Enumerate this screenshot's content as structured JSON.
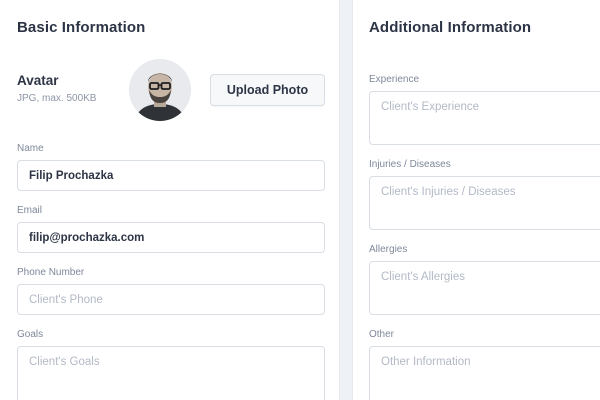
{
  "basic": {
    "title": "Basic Information",
    "avatar_label": "Avatar",
    "avatar_hint": "JPG, max. 500KB",
    "upload_label": "Upload Photo",
    "name": {
      "label": "Name",
      "value": "Filip Prochazka"
    },
    "email": {
      "label": "Email",
      "value": "filip@prochazka.com"
    },
    "phone": {
      "label": "Phone Number",
      "placeholder": "Client's Phone"
    },
    "goals": {
      "label": "Goals",
      "placeholder": "Client's Goals"
    }
  },
  "additional": {
    "title": "Additional Information",
    "experience": {
      "label": "Experience",
      "placeholder": "Client's Experience"
    },
    "injuries": {
      "label": "Injuries / Diseases",
      "placeholder": "Client's Injuries / Diseases"
    },
    "allergies": {
      "label": "Allergies",
      "placeholder": "Client's Allergies"
    },
    "other": {
      "label": "Other",
      "placeholder": "Other Information"
    }
  }
}
